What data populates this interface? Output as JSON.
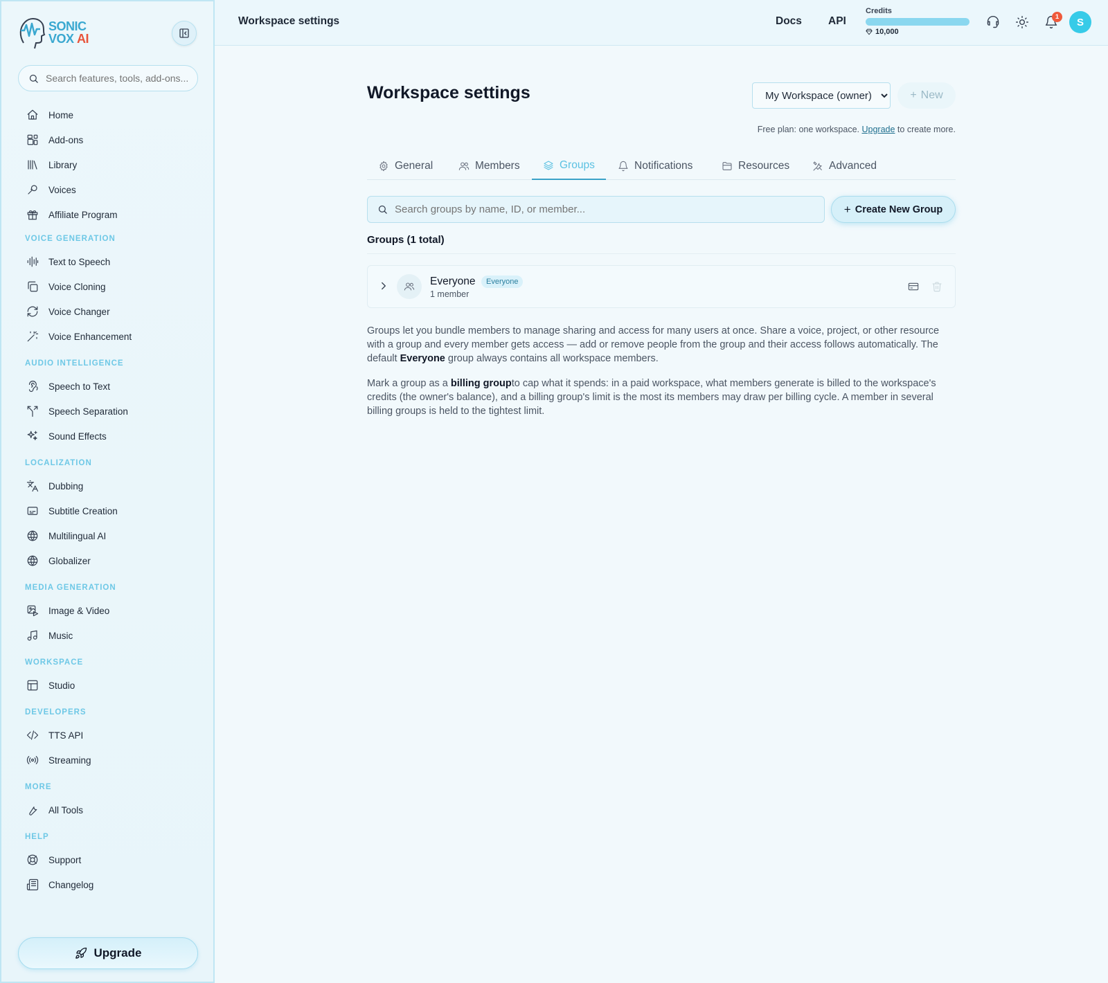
{
  "brand": {
    "line1": "SONIC",
    "line2": "VOX",
    "ai": "AI"
  },
  "sidebar": {
    "search_placeholder": "Search features, tools, add-ons...",
    "top_items": [
      {
        "label": "Home",
        "icon": "home-icon"
      },
      {
        "label": "Add-ons",
        "icon": "addons-icon"
      },
      {
        "label": "Library",
        "icon": "library-icon"
      },
      {
        "label": "Voices",
        "icon": "voices-icon"
      },
      {
        "label": "Affiliate Program",
        "icon": "gift-icon"
      }
    ],
    "sections": [
      {
        "title": "VOICE GENERATION",
        "items": [
          {
            "label": "Text to Speech",
            "icon": "waveform-icon"
          },
          {
            "label": "Voice Cloning",
            "icon": "copy-icon"
          },
          {
            "label": "Voice Changer",
            "icon": "refresh-icon"
          },
          {
            "label": "Voice Enhancement",
            "icon": "wand-icon"
          }
        ]
      },
      {
        "title": "AUDIO INTELLIGENCE",
        "items": [
          {
            "label": "Speech to Text",
            "icon": "ear-icon"
          },
          {
            "label": "Speech Separation",
            "icon": "split-icon"
          },
          {
            "label": "Sound Effects",
            "icon": "sparkles-icon"
          }
        ]
      },
      {
        "title": "LOCALIZATION",
        "items": [
          {
            "label": "Dubbing",
            "icon": "translate-icon"
          },
          {
            "label": "Subtitle Creation",
            "icon": "subtitle-icon"
          },
          {
            "label": "Multilingual AI",
            "icon": "globe-icon"
          },
          {
            "label": "Globalizer",
            "icon": "globe-icon"
          }
        ]
      },
      {
        "title": "MEDIA GENERATION",
        "items": [
          {
            "label": "Image & Video",
            "icon": "image-video-icon"
          },
          {
            "label": "Music",
            "icon": "music-icon"
          }
        ]
      },
      {
        "title": "WORKSPACE",
        "items": [
          {
            "label": "Studio",
            "icon": "layout-icon"
          }
        ]
      },
      {
        "title": "DEVELOPERS",
        "items": [
          {
            "label": "TTS API",
            "icon": "code-icon"
          },
          {
            "label": "Streaming",
            "icon": "radio-icon"
          }
        ]
      },
      {
        "title": "MORE",
        "items": [
          {
            "label": "All Tools",
            "icon": "wrench-icon"
          }
        ]
      },
      {
        "title": "HELP",
        "items": [
          {
            "label": "Support",
            "icon": "lifebuoy-icon"
          },
          {
            "label": "Changelog",
            "icon": "newspaper-icon"
          }
        ]
      }
    ],
    "upgrade_label": "Upgrade"
  },
  "topbar": {
    "title": "Workspace settings",
    "docs": "Docs",
    "api": "API",
    "credits_label": "Credits",
    "credits_value": "10,000",
    "notification_count": "1",
    "avatar_initial": "S"
  },
  "main": {
    "title": "Workspace settings",
    "workspace_select": "My Workspace (owner)",
    "new_label": "New",
    "free_plan_prefix": "Free plan: one workspace.",
    "free_plan_link": "Upgrade",
    "free_plan_suffix": "to create more.",
    "tabs": [
      {
        "label": "General",
        "icon": "gear-icon"
      },
      {
        "label": "Members",
        "icon": "users-icon"
      },
      {
        "label": "Groups",
        "icon": "layers-icon",
        "active": true
      },
      {
        "label": "Notifications",
        "icon": "bell-icon"
      },
      {
        "label": "Resources",
        "icon": "folder-icon"
      },
      {
        "label": "Advanced",
        "icon": "tools-icon"
      }
    ],
    "group_search_placeholder": "Search groups by name, ID, or member...",
    "create_group_label": "Create New Group",
    "groups_heading": "Groups (1 total)",
    "groups": [
      {
        "name": "Everyone",
        "badge": "Everyone",
        "count": "1 member"
      }
    ],
    "para1": {
      "before": "Groups let you bundle members to manage sharing and access for many users at once. Share a voice, project, or other resource with a group and every member gets access — add or remove people from the group and their access follows automatically. The default ",
      "bold": "Everyone",
      "after": " group always contains all workspace members."
    },
    "para2": {
      "before": "Mark a group as a ",
      "bold": "billing group",
      "after": "to cap what it spends: in a paid workspace, what members generate is billed to the workspace's credits (the owner's balance), and a billing group's limit is the most its members may draw per billing cycle. A member in several billing groups is held to the tightest limit."
    }
  }
}
